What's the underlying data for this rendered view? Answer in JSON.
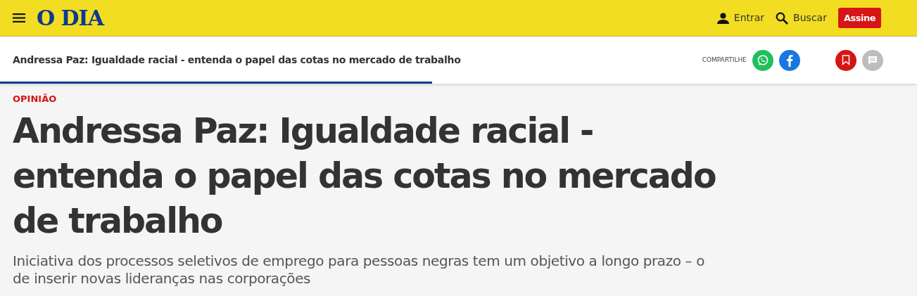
{
  "header": {
    "logo": "O DIA",
    "login": "Entrar",
    "search": "Buscar",
    "subscribe": "Assine"
  },
  "sticky_bar": {
    "title": "Andressa Paz: Igualdade racial - entenda o papel das cotas no mercado de trabalho",
    "share_label": "COMPARTILHE",
    "reading_progress": {
      "level": 0.471
    }
  },
  "article": {
    "section": "OPINIÃO",
    "headline": "Andressa Paz: Igualdade racial - entenda o papel das cotas no mercado de trabalho",
    "subtitle": "Iniciativa dos processos seletivos de emprego para pessoas negras tem um objetivo a longo prazo – o de inserir novas lideranças nas corporações"
  }
}
